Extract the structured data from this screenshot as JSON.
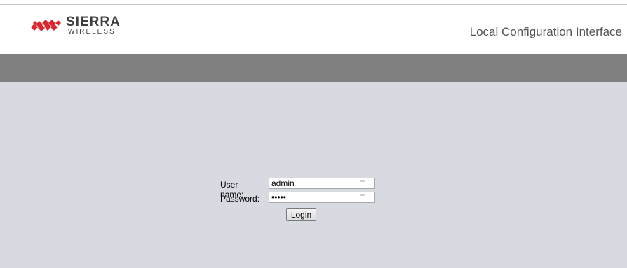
{
  "header": {
    "brand": "SIERRA",
    "brand_sub": "WIRELESS",
    "title": "Local Configuration Interface"
  },
  "login": {
    "username_label": "User name:",
    "username_value": "admin",
    "password_label": "Password:",
    "password_value": "admin",
    "field_icon": "***|",
    "login_label": "Login"
  },
  "colors": {
    "nav_bar": "#808080",
    "main_bg": "#d7dbe1",
    "logo_red": "#d7282f"
  },
  "icons": [
    "sierra-wireless-logo-icon",
    "password-manager-icon"
  ]
}
